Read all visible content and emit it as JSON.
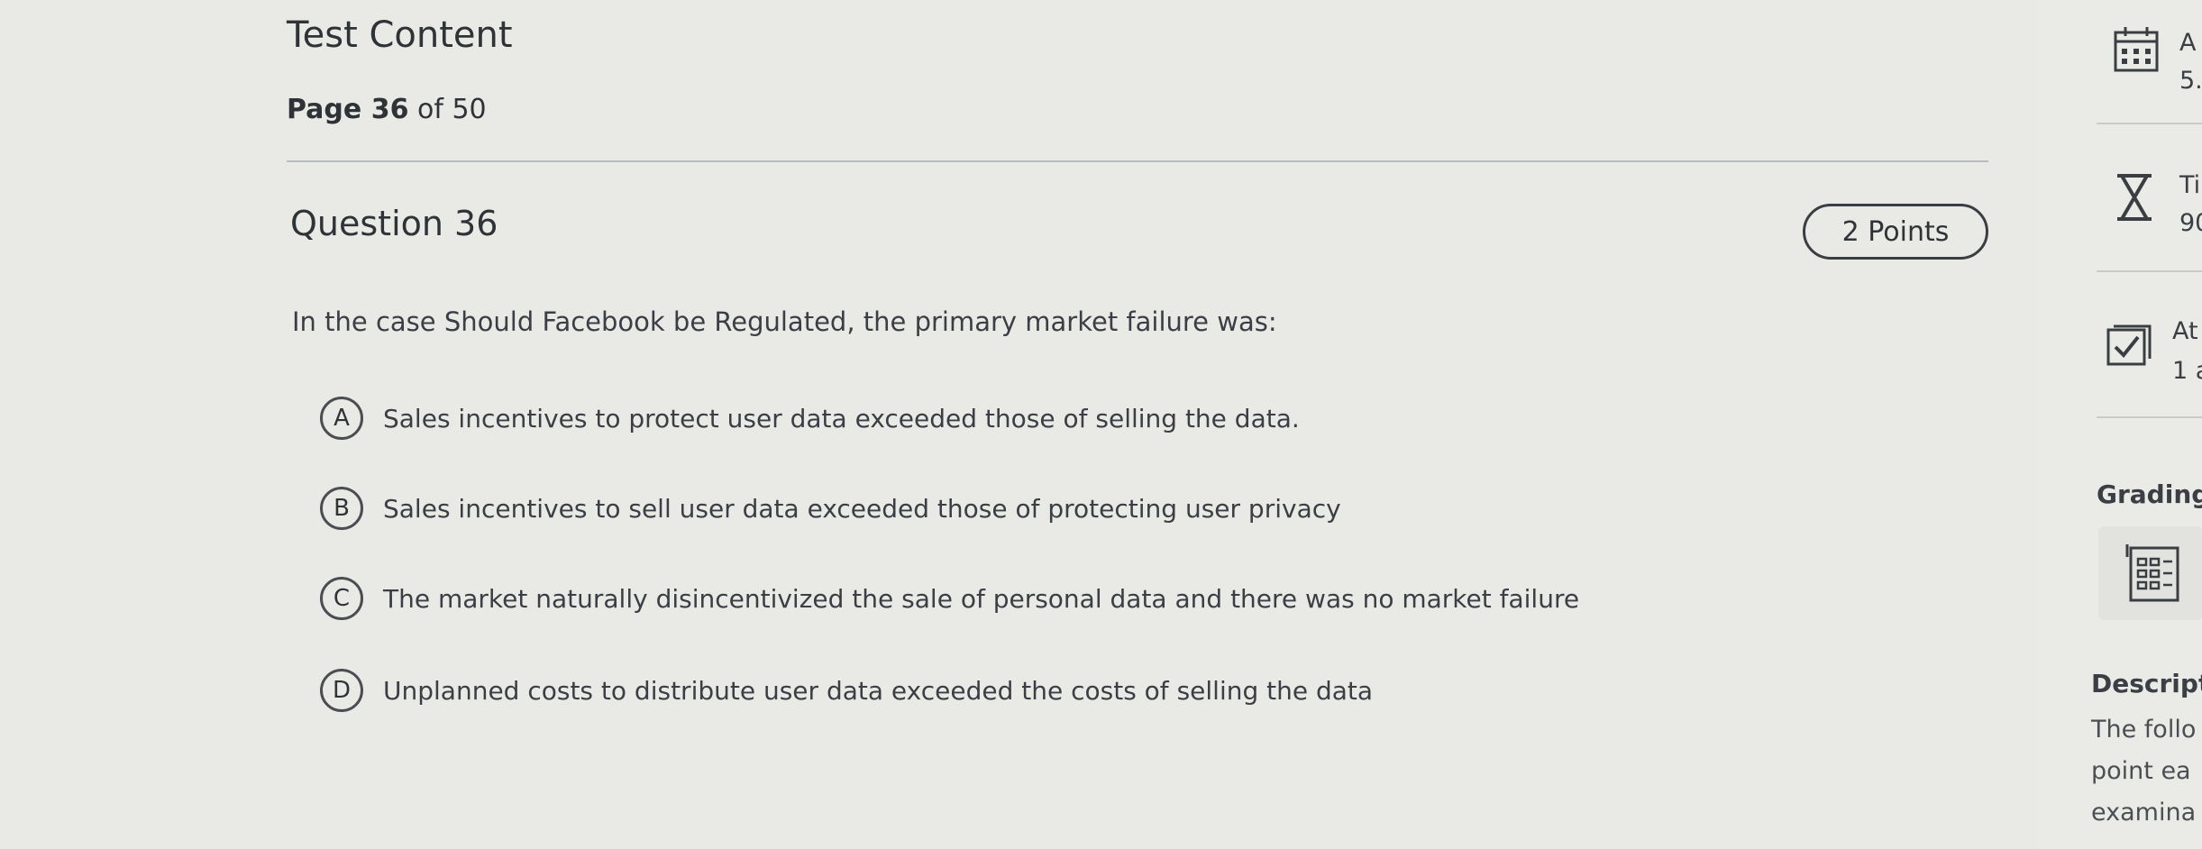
{
  "test": {
    "title": "Test Content",
    "page_prefix": "Page 36",
    "page_suffix": " of 50"
  },
  "question": {
    "title": "Question 36",
    "points": "2 Points",
    "prompt": "In the case Should Facebook be Regulated, the primary market failure was:",
    "options": [
      {
        "letter": "A",
        "text": "Sales incentives to protect user data exceeded those of selling the data."
      },
      {
        "letter": "B",
        "text": "Sales incentives to sell user data exceeded those of protecting user privacy"
      },
      {
        "letter": "C",
        "text": "The market naturally disincentivized the sale of personal data and there was no market failure"
      },
      {
        "letter": "D",
        "text": "Unplanned costs to distribute user data exceeded the costs of selling the data"
      }
    ]
  },
  "sidebar": {
    "due": {
      "label": "A",
      "value": "5."
    },
    "time": {
      "label": "Ti",
      "value": "90"
    },
    "attempts": {
      "label": "At",
      "value": "1 a"
    },
    "grading_heading": "Grading",
    "description_heading": "Descript",
    "description_lines": [
      "The follo",
      "point ea",
      "examina"
    ],
    "icons": [
      "calendar-icon",
      "hourglass-icon",
      "checkbox-icon",
      "grading-rubric-icon"
    ]
  }
}
